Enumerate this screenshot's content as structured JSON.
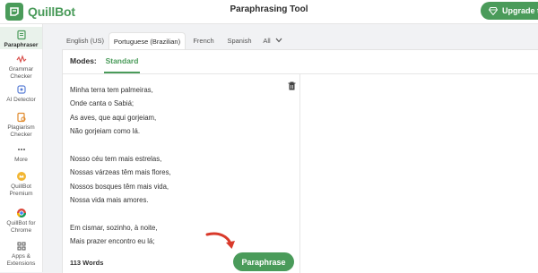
{
  "header": {
    "logo_text": "QuillBot",
    "title": "Paraphrasing Tool",
    "upgrade_label": "Upgrade to P"
  },
  "sidebar": {
    "items": [
      {
        "label": "Paraphraser",
        "icon": "paraphraser-icon",
        "active": true
      },
      {
        "label": "Grammar Checker",
        "icon": "grammar-icon"
      },
      {
        "label": "AI Detector",
        "icon": "ai-detector-icon"
      },
      {
        "label": "Plagiarism Checker",
        "icon": "plagiarism-icon"
      },
      {
        "label": "More",
        "icon": "more-icon"
      },
      {
        "label": "QuillBot Premium",
        "icon": "premium-icon"
      },
      {
        "label": "QuillBot for Chrome",
        "icon": "chrome-icon"
      },
      {
        "label": "Apps & Extensions",
        "icon": "apps-icon"
      }
    ]
  },
  "languages": {
    "tabs": [
      "English (US)",
      "Portuguese (Brazilian)",
      "French",
      "Spanish",
      "All"
    ],
    "active": "Portuguese (Brazilian)"
  },
  "modes": {
    "label": "Modes:",
    "current": "Standard"
  },
  "editor": {
    "lines": [
      "Minha terra tem palmeiras,",
      "Onde canta o Sabiá;",
      "As aves, que aqui gorjeiam,",
      "Não gorjeiam como lá.",
      "",
      "Nosso céu tem mais estrelas,",
      "Nossas várzeas têm mais flores,",
      "Nossos bosques têm mais vida,",
      "Nossa vida mais amores.",
      "",
      "Em cismar, sozinho, à noite,",
      "Mais prazer encontro eu lá;"
    ],
    "word_count": "113 Words"
  },
  "actions": {
    "paraphrase_label": "Paraphrase"
  },
  "colors": {
    "brand": "#4a9b5a",
    "arrow": "#d93a2b"
  }
}
